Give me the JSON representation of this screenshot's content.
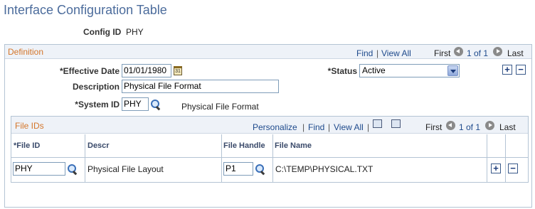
{
  "page": {
    "title": "Interface Configuration Table"
  },
  "config": {
    "label": "Config ID",
    "value": "PHY"
  },
  "definition": {
    "title": "Definition",
    "nav": {
      "find": "Find",
      "sep": "|",
      "view_all": "View All",
      "first": "First",
      "range": "1 of 1",
      "last": "Last"
    },
    "effective_date": {
      "label": "*Effective Date",
      "value": "01/01/1980"
    },
    "status": {
      "label": "*Status",
      "value": "Active"
    },
    "description": {
      "label": "Description",
      "value": "Physical File Format"
    },
    "system_id": {
      "label": "*System ID",
      "value": "PHY",
      "descr": "Physical File Format"
    },
    "add_label": "+",
    "delete_label": "−"
  },
  "file_ids": {
    "title": "File IDs",
    "toolbar": {
      "personalize": "Personalize",
      "find": "Find",
      "view_all": "View All",
      "sep": "|",
      "first": "First",
      "range": "1 of 1",
      "last": "Last"
    },
    "columns": [
      "*File ID",
      "Descr",
      "File Handle",
      "File Name"
    ],
    "rows": [
      {
        "file_id": "PHY",
        "descr": "Physical File Layout",
        "file_handle": "P1",
        "file_name": "C:\\TEMP\\PHYSICAL.TXT"
      }
    ],
    "add_label": "+",
    "delete_label": "−"
  },
  "icons": {
    "calendar": "calendar-icon",
    "lookup": "magnifier-icon",
    "prev": "prev-arrow-icon",
    "next": "next-arrow-icon",
    "download": "download-grid-icon",
    "zoom": "zoom-grid-icon"
  }
}
